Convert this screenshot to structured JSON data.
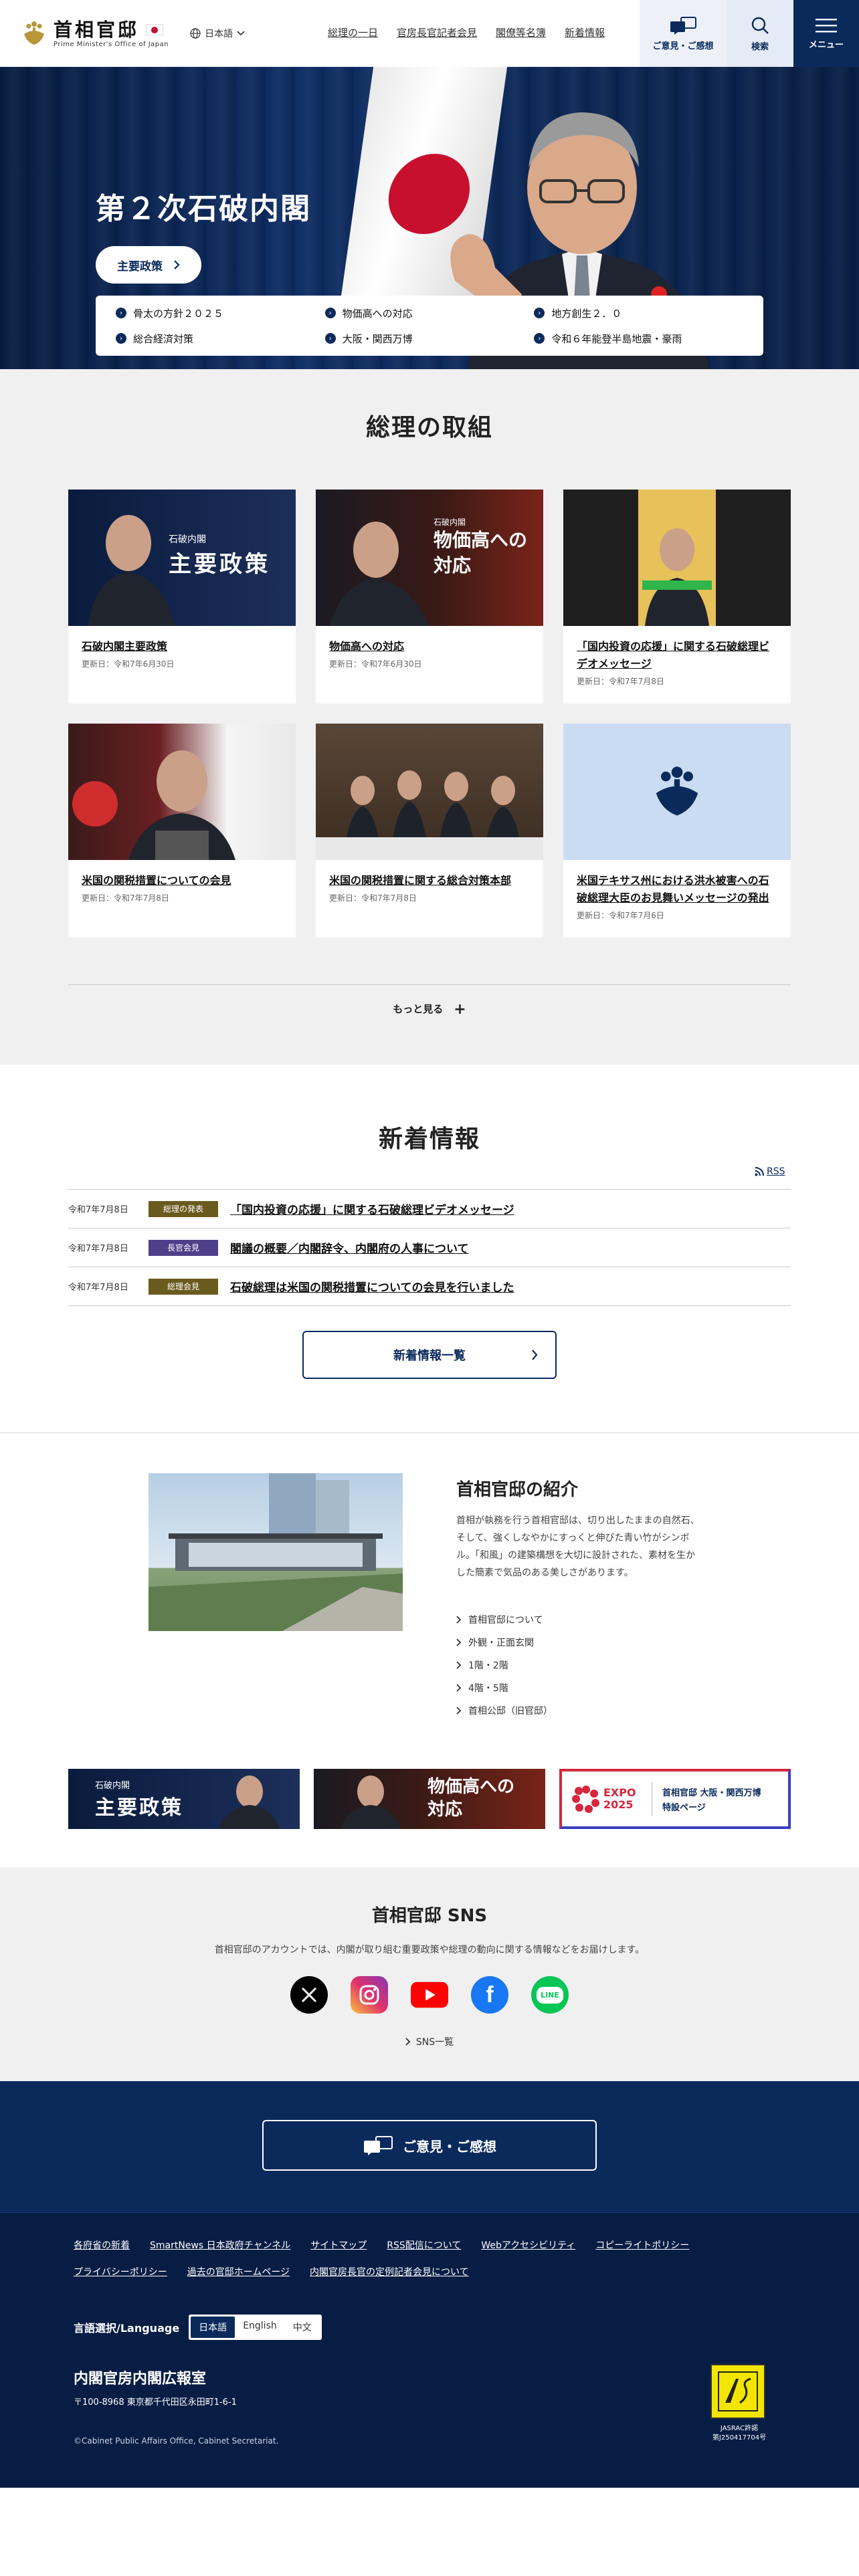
{
  "header": {
    "logo_jp": "首相官邸",
    "logo_en": "Prime Minister's Office of Japan",
    "language": "日本語",
    "nav": [
      "総理の一日",
      "官房長官記者会見",
      "閣僚等名簿",
      "新着情報"
    ],
    "opinion_label": "ご意見・ご感想",
    "search_label": "検索",
    "menu_label": "メニュー"
  },
  "hero": {
    "title": "第２次石破内閣",
    "button": "主要政策",
    "links": [
      "骨太の方針２０２５",
      "物価高への対応",
      "地方創生２．０",
      "総合経済対策",
      "大阪・関西万博",
      "令和６年能登半島地震・豪雨"
    ]
  },
  "initiatives": {
    "title": "総理の取組",
    "cards": [
      {
        "title": "石破内閣主要政策",
        "date": "更新日：令和7年6月30日",
        "overlay_small": "石破内閣",
        "overlay_big": "主要政策"
      },
      {
        "title": "物価高への対応",
        "date": "更新日：令和7年6月30日",
        "overlay_small": "石破内閣",
        "overlay_big1": "物価高への",
        "overlay_big2": "対応"
      },
      {
        "title": "「国内投資の応援」に関する石破総理ビデオメッセージ",
        "date": "更新日：令和7年7月8日"
      },
      {
        "title": "米国の関税措置についての会見",
        "date": "更新日：令和7年7月8日"
      },
      {
        "title": "米国の関税措置に関する総合対策本部",
        "date": "更新日：令和7年7月8日"
      },
      {
        "title": "米国テキサス州における洪水被害への石破総理大臣のお見舞いメッセージの発出",
        "date": "更新日：令和7年7月6日"
      }
    ],
    "more": "もっと見る"
  },
  "news": {
    "title": "新着情報",
    "rss": "RSS",
    "items": [
      {
        "date": "令和7年7月8日",
        "badge": "総理の発表",
        "badge_color": "#6b5a1e",
        "text": "「国内投資の応援」に関する石破総理ビデオメッセージ"
      },
      {
        "date": "令和7年7月8日",
        "badge": "長官会見",
        "badge_color": "#4e3f8a",
        "text": "閣議の概要／内閣辞令、内閣府の人事について"
      },
      {
        "date": "令和7年7月8日",
        "badge": "総理会見",
        "badge_color": "#6b5a1e",
        "text": "石破総理は米国の関税措置についての会見を行いました"
      }
    ],
    "list_button": "新着情報一覧"
  },
  "intro": {
    "title": "首相官邸の紹介",
    "desc": "首相が執務を行う首相官邸は、切り出したままの自然石、そして、強くしなやかにすっくと伸びた青い竹がシンボル。「和風」の建築構想を大切に設計された、素材を生かした簡素で気品のある美しさがあります。",
    "links": [
      "首相官邸について",
      "外観・正面玄関",
      "1階・2階",
      "4階・5階",
      "首相公邸（旧官邸）"
    ],
    "banner1_small": "石破内閣",
    "banner1_big": "主要政策",
    "banner2_line1": "物価高への",
    "banner2_line2": "対応",
    "banner3_expo": "EXPO",
    "banner3_year": "2025",
    "banner3_line1": "首相官邸 大阪・関西万博",
    "banner3_line2": "特設ページ"
  },
  "sns": {
    "title": "首相官邸 SNS",
    "desc": "首相官邸のアカウントでは、内閣が取り組む重要政策や総理の動向に関する情報などをお届けします。",
    "icons": [
      "x-icon",
      "instagram-icon",
      "youtube-icon",
      "facebook-icon",
      "line-icon"
    ],
    "line_label": "LINE",
    "link": "SNS一覧"
  },
  "footer": {
    "opinion": "ご意見・ご感想",
    "links": [
      "各府省の新着",
      "SmartNews 日本政府チャンネル",
      "サイトマップ",
      "RSS配信について",
      "Webアクセシビリティ",
      "コピーライトポリシー",
      "プライバシーポリシー",
      "過去の官邸ホームページ",
      "内閣官房長官の定例記者会見について"
    ],
    "lang_label": "言語選択/Language",
    "langs": [
      "日本語",
      "English",
      "中文"
    ],
    "org": "内閣官房内閣広報室",
    "address": "〒100-8968 東京都千代田区永田町1-6-1",
    "copyright": "©Cabinet Public Affairs Office, Cabinet Secretariat.",
    "jasrac_line1": "JASRAC許諾",
    "jasrac_line2": "第J250417704号"
  },
  "colors": {
    "navy": "#0b2a5c",
    "footer_dark": "#081d44",
    "grey_bg": "#f0f0f0"
  }
}
